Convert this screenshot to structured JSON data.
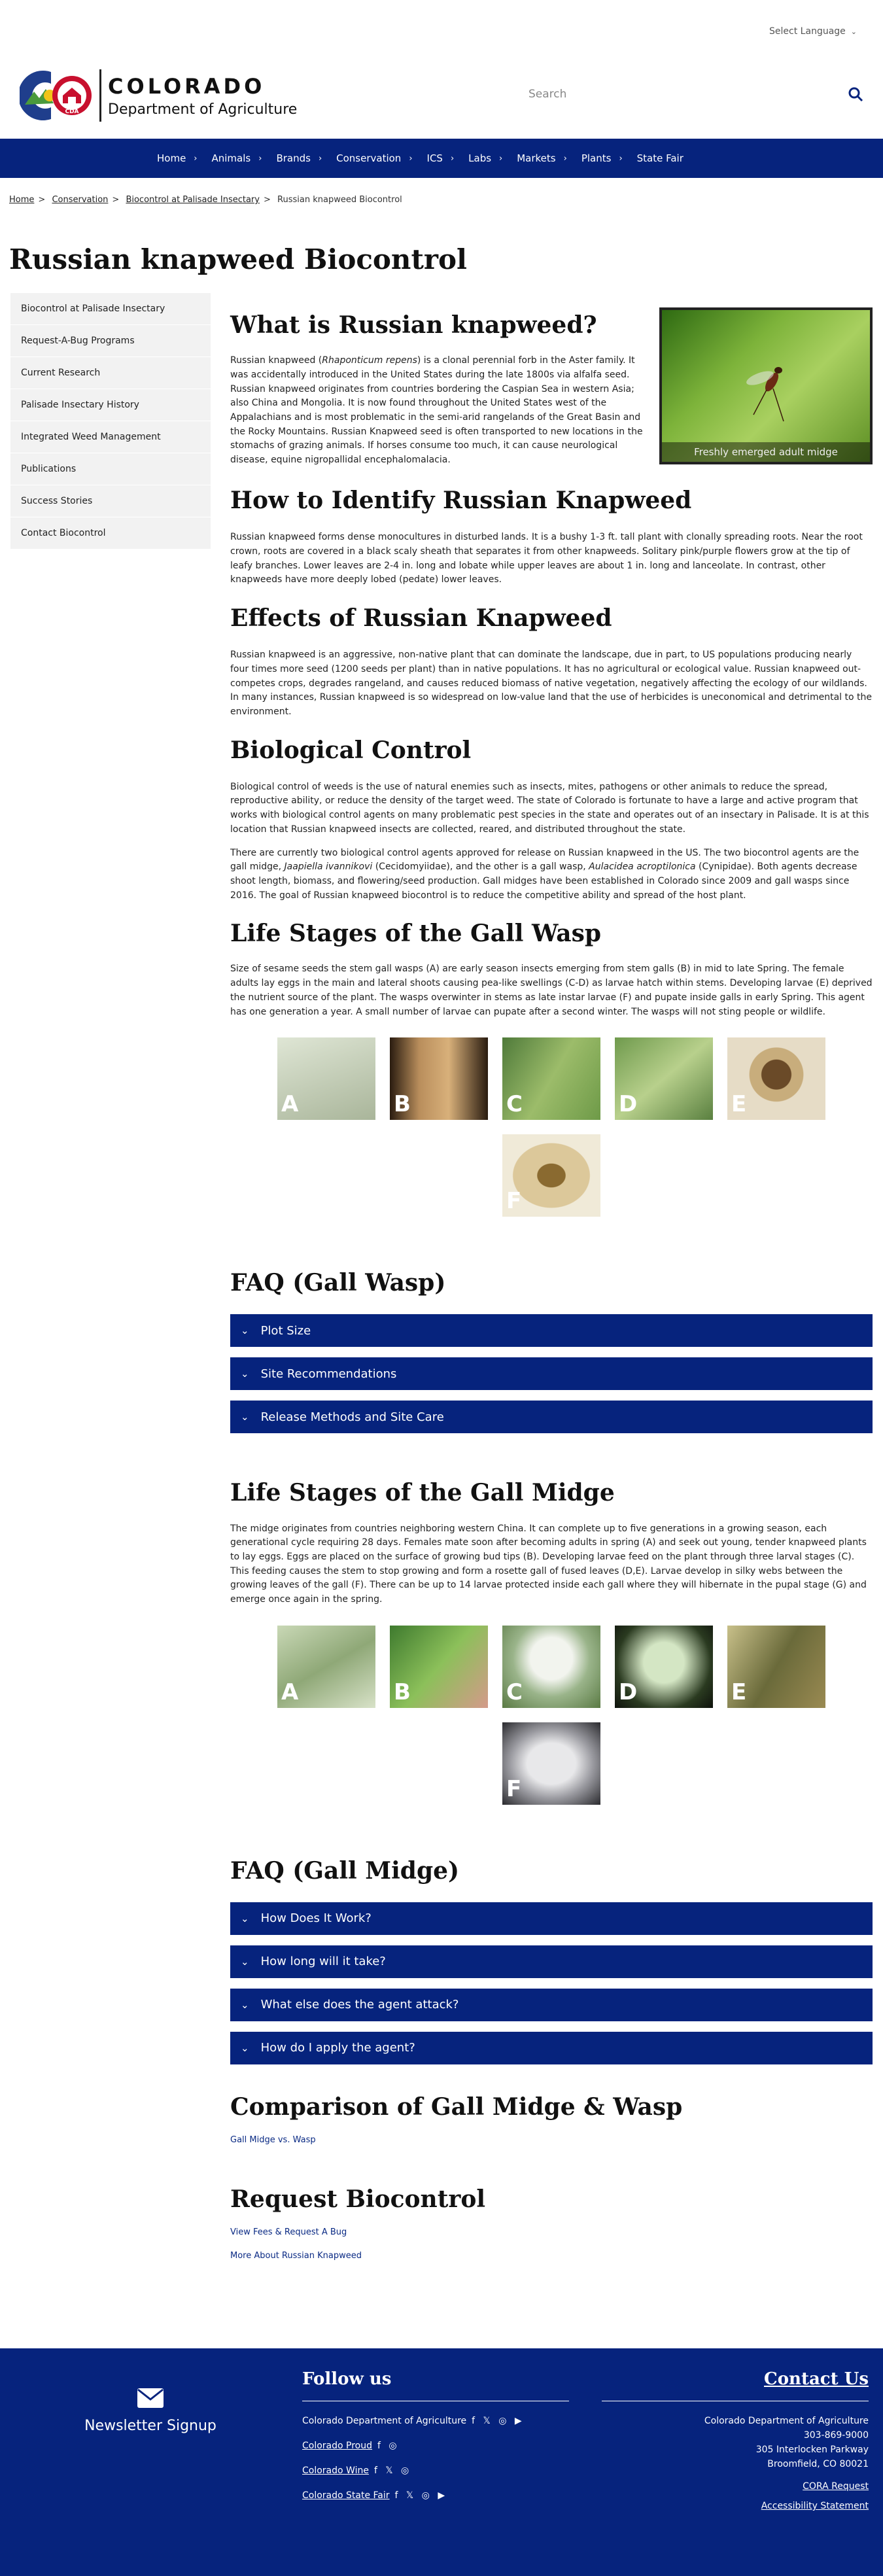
{
  "header": {
    "language_label": "Select Language",
    "logo_line1": "COLORADO",
    "logo_line2": "Department of Agriculture",
    "logo_badge": "CDA",
    "search_placeholder": "Search"
  },
  "nav": [
    "Home",
    "Animals",
    "Brands",
    "Conservation",
    "ICS",
    "Labs",
    "Markets",
    "Plants",
    "State Fair"
  ],
  "breadcrumb": [
    "Home",
    "Conservation",
    "Biocontrol at Palisade Insectary",
    "Russian knapweed Biocontrol"
  ],
  "page_title": "Russian knapweed Biocontrol",
  "sidebar": [
    "Biocontrol at Palisade Insectary",
    "Request-A-Bug Programs",
    "Current Research",
    "Palisade Insectary History",
    "Integrated Weed Management",
    "Publications",
    "Success Stories",
    "Contact Biocontrol"
  ],
  "sections": {
    "what": {
      "heading": "What is Russian knapweed?",
      "image_caption": "Freshly emerged adult midge",
      "p_before": "Russian knapweed (",
      "p_italic": "Rhaponticum repens",
      "p_after": ") is a clonal perennial forb in the Aster family. It was accidentally introduced in the United States during the late 1800s via alfalfa seed. Russian knapweed originates from countries bordering the Caspian Sea in western Asia; also China and Mongolia. It is now found throughout the United States west of the Appalachians and is most problematic in the semi-arid rangelands of the Great Basin and the Rocky Mountains. Russian Knapweed seed is often transported to new locations in the stomachs of grazing animals. If horses consume too much, it can cause neurological disease, equine nigropallidal encephalomalacia."
    },
    "identify": {
      "heading": "How to Identify Russian Knapweed",
      "p": "Russian knapweed forms dense monocultures in disturbed lands. It is a bushy 1-3 ft. tall plant with clonally spreading roots. Near the root crown, roots are covered in a black scaly sheath that separates it from other knapweeds. Solitary pink/purple flowers grow at the tip of leafy branches. Lower leaves are 2-4 in. long and lobate while upper leaves are about 1 in. long and lanceolate. In contrast, other knapweeds have more deeply lobed (pedate) lower leaves."
    },
    "effects": {
      "heading": "Effects of Russian Knapweed",
      "p": "Russian knapweed is an aggressive, non-native plant that can dominate the landscape, due in part, to US populations producing nearly four times more seed (1200 seeds per plant) than in native populations. It has no agricultural or ecological value. Russian knapweed out-competes crops, degrades rangeland, and causes reduced biomass of native vegetation, negatively affecting the ecology of our wildlands. In many instances, Russian knapweed is so widespread on low-value land that the use of herbicides is uneconomical and detrimental to the environment."
    },
    "bio": {
      "heading": "Biological Control",
      "p1": "Biological control of weeds is the use of natural enemies such as insects, mites, pathogens or other animals to reduce the spread, reproductive ability, or reduce the density of the target weed. The state of Colorado is fortunate to have a large and active program that works with biological control agents on many problematic pest species in the state and operates out of an insectary in Palisade. It is at this location that Russian knapweed insects are collected, reared, and distributed throughout the state.",
      "p2_a": "There are currently two biological control agents approved for release on Russian knapweed in the US. The two biocontrol agents are the gall midge, ",
      "p2_i1": "Jaapiella ivannikovi",
      "p2_b": " (Cecidomyiidae), and the other is a gall wasp, ",
      "p2_i2": "Aulacidea acroptilonica",
      "p2_c": " (Cynipidae). Both agents decrease shoot length, biomass, and flowering/seed production. Gall midges have been established in Colorado since 2009 and gall wasps since 2016. The goal of Russian knapweed biocontrol is to reduce the competitive ability and spread of the host plant."
    },
    "wasp": {
      "heading": "Life Stages of the Gall Wasp",
      "p": "Size of sesame seeds the stem gall wasps (A) are early season insects emerging from stem galls (B) in mid to late Spring. The female adults lay eggs in the main and lateral shoots causing pea-like swellings (C-D) as larvae hatch within stems. Developing larvae (E) deprived the nutrient source of the plant. The wasps overwinter in stems as late instar larvae (F) and pupate inside galls in early Spring. This agent has one generation a year. A small number of larvae can pupate after a second winter. The wasps will not sting people or wildlife.",
      "labels": [
        "A",
        "B",
        "C",
        "D",
        "E",
        "F"
      ]
    },
    "faq_wasp": {
      "heading": "FAQ (Gall Wasp)",
      "items": [
        "Plot Size",
        "Site Recommendations",
        "Release Methods and Site Care"
      ]
    },
    "midge": {
      "heading": "Life Stages of the Gall Midge",
      "p": "The midge originates from countries neighboring western China. It can complete up to five generations in a growing season, each generational cycle requiring 28 days. Females mate soon after becoming adults in spring (A) and seek out young, tender knapweed plants to lay eggs. Eggs are placed on the surface of growing bud tips (B). Developing larvae feed on the plant through three larval stages (C). This feeding causes the stem to stop growing and form a rosette gall of fused leaves (D,E). Larvae develop in silky webs between the growing leaves of the gall (F). There can be up to 14 larvae protected inside each gall where they will hibernate in the pupal stage (G) and emerge once again in the spring.",
      "labels": [
        "A",
        "B",
        "C",
        "D",
        "E",
        "F"
      ]
    },
    "faq_midge": {
      "heading": "FAQ (Gall Midge)",
      "items": [
        "How Does It Work?",
        "How long will it take?",
        "What else does the agent attack?",
        "How do I apply the agent?"
      ]
    },
    "compare": {
      "heading": "Comparison of Gall Midge & Wasp",
      "link": "Gall Midge vs. Wasp"
    },
    "request": {
      "heading": "Request Biocontrol",
      "links": [
        "View Fees & Request A Bug",
        "More About Russian Knapweed"
      ]
    }
  },
  "footer": {
    "newsletter": "Newsletter Signup",
    "follow_heading": "Follow us",
    "follow_rows": [
      "Colorado Department of Agriculture",
      "Colorado Proud",
      "Colorado Wine",
      "Colorado State Fair"
    ],
    "contact_heading": "Contact Us",
    "contact_lines": [
      "Colorado Department of Agriculture",
      "303-869-9000",
      "305 Interlocken Parkway",
      "Broomfield, CO 80021"
    ],
    "contact_links": [
      "CORA Request",
      "Accessibility Statement"
    ]
  },
  "colors": {
    "primary": "#06237d",
    "text": "#222222"
  }
}
